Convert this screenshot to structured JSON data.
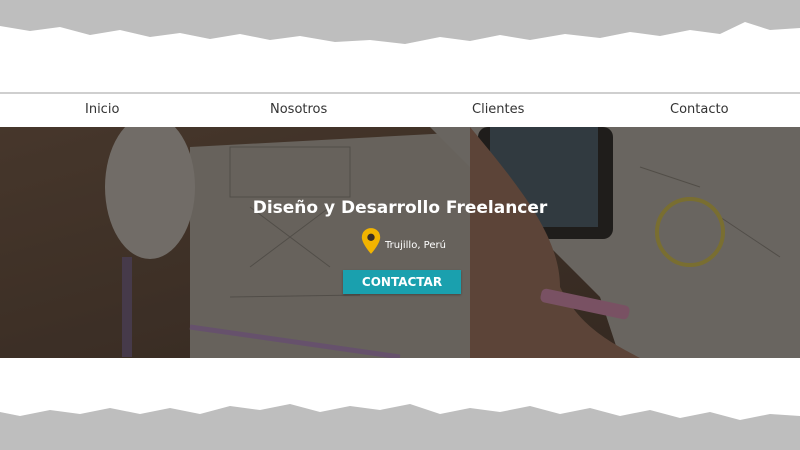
{
  "colors": {
    "accent": "#1aa0ae",
    "pin": "#f2b400",
    "border_gray": "#bebebe"
  },
  "nav": {
    "items": [
      {
        "label": "Inicio"
      },
      {
        "label": "Nosotros"
      },
      {
        "label": "Clientes"
      },
      {
        "label": "Contacto"
      }
    ]
  },
  "hero": {
    "title": "Diseño y Desarrollo Freelancer",
    "location": "Trujillo, Perú",
    "location_icon": "map-pin-icon",
    "cta_label": "CONTACTAR"
  }
}
